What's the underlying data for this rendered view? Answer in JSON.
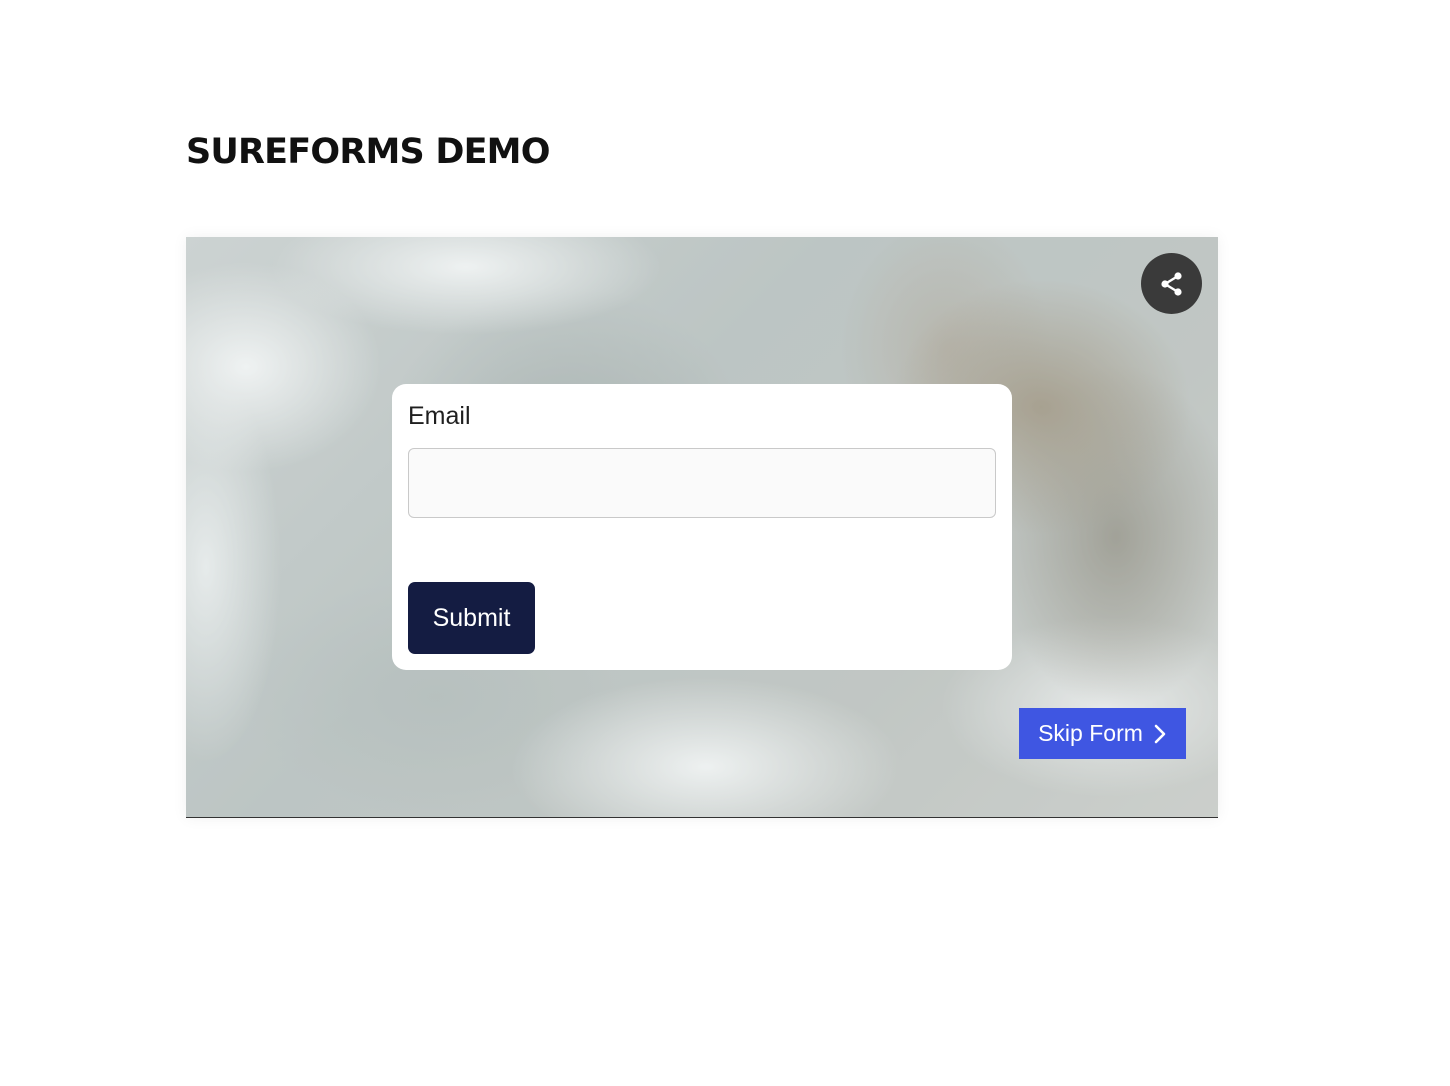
{
  "page": {
    "title": "SUREFORMS DEMO"
  },
  "video": {
    "share_icon": "share-icon"
  },
  "form": {
    "email_label": "Email",
    "email_value": "",
    "email_placeholder": "",
    "submit_label": "Submit"
  },
  "skip": {
    "label": "Skip Form",
    "icon": "chevron-right-icon"
  },
  "colors": {
    "submit_bg": "#141c42",
    "skip_bg": "#3f56e2",
    "share_bg": "#3a3a3a"
  }
}
